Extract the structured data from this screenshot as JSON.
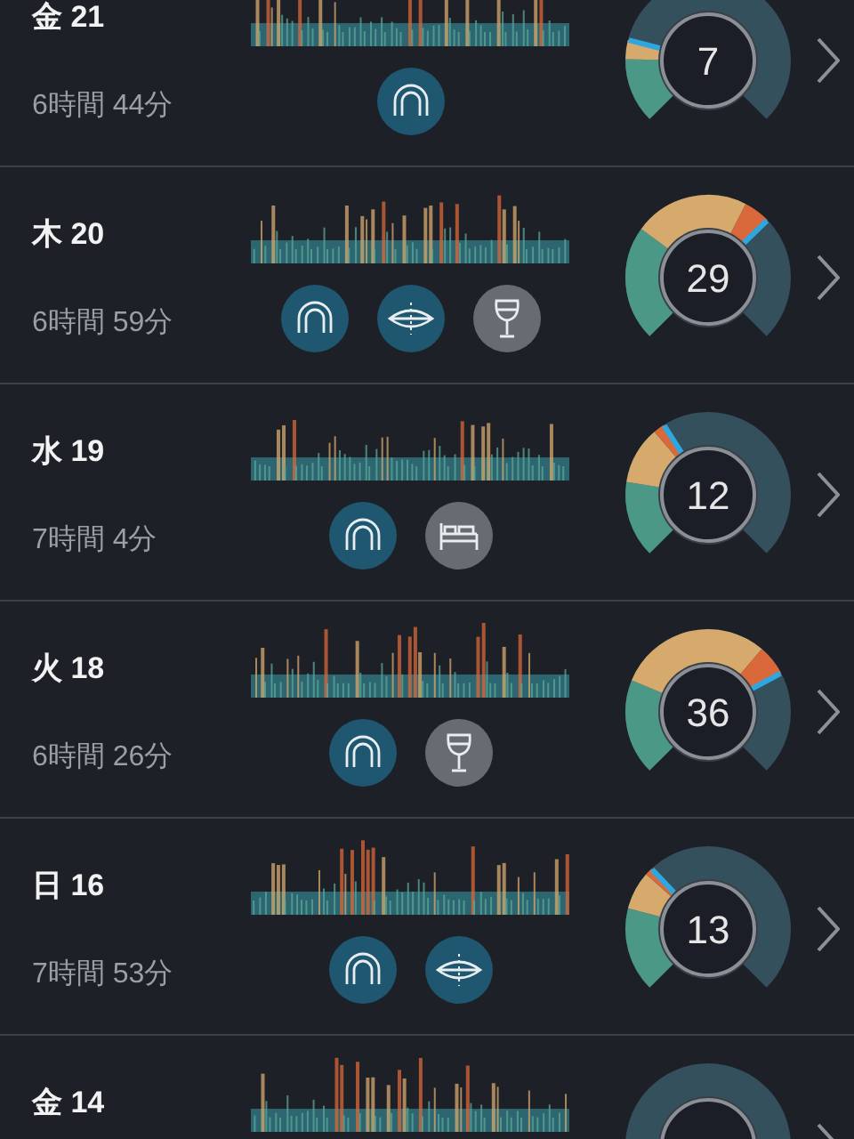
{
  "nights": [
    {
      "day": "金 21",
      "duration": "6時間 44分",
      "score": "7",
      "remedies": [
        {
          "kind": "mouthguard"
        }
      ]
    },
    {
      "day": "木 20",
      "duration": "6時間 59分",
      "score": "29",
      "remedies": [
        {
          "kind": "mouthguard"
        },
        {
          "kind": "mouth"
        },
        {
          "kind": "alcohol"
        }
      ]
    },
    {
      "day": "水 19",
      "duration": "7時間 4分",
      "score": "12",
      "remedies": [
        {
          "kind": "mouthguard"
        },
        {
          "kind": "bed"
        }
      ]
    },
    {
      "day": "火 18",
      "duration": "6時間 26分",
      "score": "36",
      "remedies": [
        {
          "kind": "mouthguard"
        },
        {
          "kind": "alcohol"
        }
      ]
    },
    {
      "day": "日 16",
      "duration": "7時間 53分",
      "score": "13",
      "remedies": [
        {
          "kind": "mouthguard"
        },
        {
          "kind": "mouth"
        }
      ]
    },
    {
      "day": "金 14"
    }
  ]
}
